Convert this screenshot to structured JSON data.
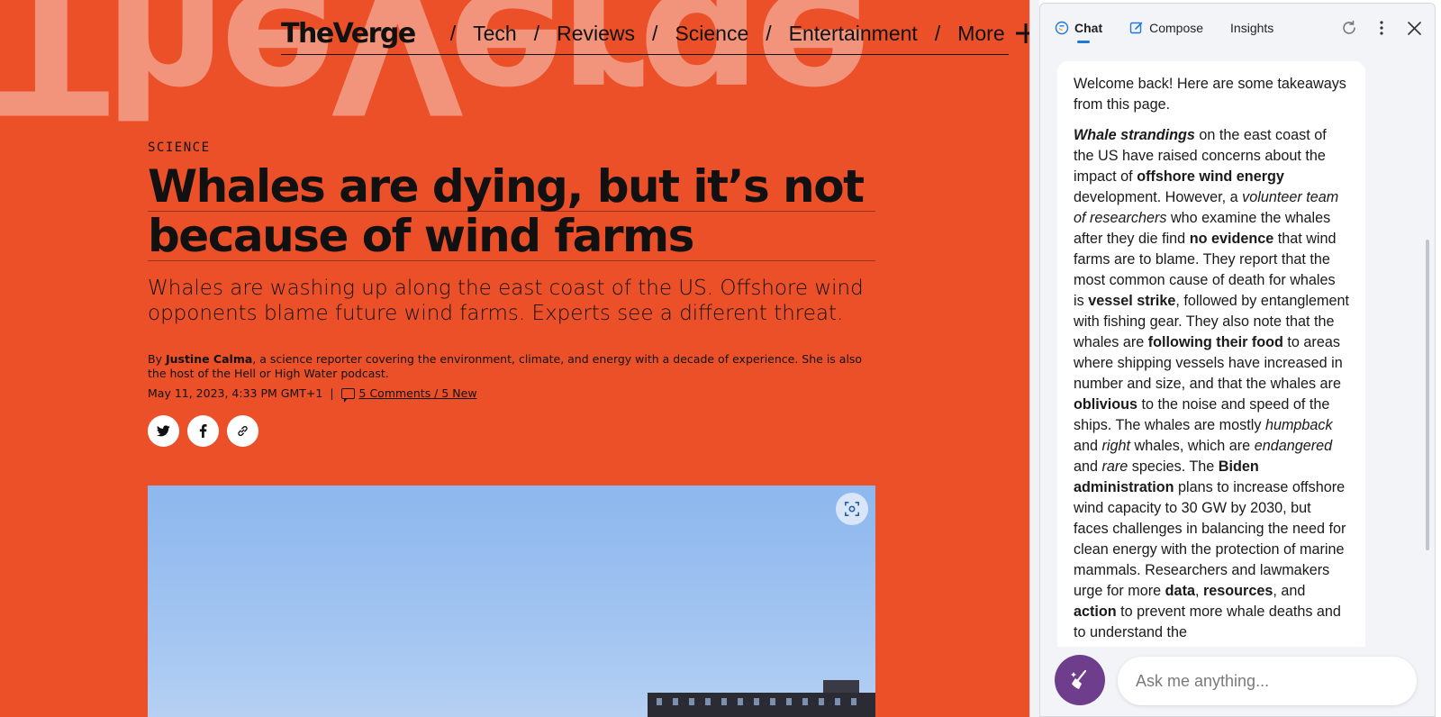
{
  "article_page": {
    "background_color": "#eb5028",
    "bg_logo_text": "TheVerge",
    "nav": {
      "logo": "TheVerge",
      "items": [
        "Tech",
        "Reviews",
        "Science",
        "Entertainment",
        "More"
      ],
      "separator": "/"
    },
    "kicker": "SCIENCE",
    "headline_lines": [
      "Whales are dying, but it’s not",
      "because of wind farms"
    ],
    "dek": "Whales are washing up along the east coast of the US. Offshore wind opponents blame future wind farms. Experts see a different threat.",
    "byline": {
      "prefix": "By ",
      "author": "Justine Calma",
      "bio": ", a science reporter covering the environment, climate, and energy with a decade of experience. She is also the host of the Hell or High Water podcast."
    },
    "date": "May 11, 2023, 4:33 PM GMT+1",
    "meta_separator": "|",
    "comments_link": "5 Comments / 5 New",
    "share_icons": [
      "twitter-icon",
      "facebook-icon",
      "link-icon"
    ]
  },
  "sidebar": {
    "tabs": [
      {
        "label": "Chat",
        "icon": "chat-bubble-icon",
        "active": true
      },
      {
        "label": "Compose",
        "icon": "compose-pencil-icon",
        "active": false
      },
      {
        "label": "Insights",
        "icon": "",
        "active": false
      }
    ],
    "header_icons": [
      "refresh-icon",
      "more-vertical-icon",
      "close-icon"
    ],
    "message": {
      "intro": "Welcome back! Here are some takeaways from this page.",
      "segments": [
        {
          "text": "Whale strandings",
          "style": "bolditalic"
        },
        {
          "text": " on the east coast of the US have raised concerns about the impact of ",
          "style": "normal"
        },
        {
          "text": "offshore wind energy",
          "style": "bold"
        },
        {
          "text": " development. However, a ",
          "style": "normal"
        },
        {
          "text": "volunteer team of researchers",
          "style": "italic"
        },
        {
          "text": " who examine the whales after they die find ",
          "style": "normal"
        },
        {
          "text": "no evidence",
          "style": "bold"
        },
        {
          "text": " that wind farms are to blame. They report that the most common cause of death for whales is ",
          "style": "normal"
        },
        {
          "text": "vessel strike",
          "style": "bold"
        },
        {
          "text": ", followed by entanglement with fishing gear. They also note that the whales are ",
          "style": "normal"
        },
        {
          "text": "following their food",
          "style": "bold"
        },
        {
          "text": " to areas where shipping vessels have increased in number and size, and that the whales are ",
          "style": "normal"
        },
        {
          "text": "oblivious",
          "style": "bold"
        },
        {
          "text": " to the noise and speed of the ships. The whales are mostly ",
          "style": "normal"
        },
        {
          "text": "humpback",
          "style": "italic"
        },
        {
          "text": " and ",
          "style": "normal"
        },
        {
          "text": "right",
          "style": "italic"
        },
        {
          "text": " whales, which are ",
          "style": "normal"
        },
        {
          "text": "endangered",
          "style": "italic"
        },
        {
          "text": " and ",
          "style": "normal"
        },
        {
          "text": "rare",
          "style": "italic"
        },
        {
          "text": " species. The ",
          "style": "normal"
        },
        {
          "text": "Biden administration",
          "style": "bold"
        },
        {
          "text": " plans to increase offshore wind capacity to 30 GW by 2030, but faces challenges in balancing the need for clean energy with the protection of marine mammals. Researchers and lawmakers urge for more ",
          "style": "normal"
        },
        {
          "text": "data",
          "style": "bold"
        },
        {
          "text": ", ",
          "style": "normal"
        },
        {
          "text": "resources",
          "style": "bold"
        },
        {
          "text": ", and ",
          "style": "normal"
        },
        {
          "text": "action",
          "style": "bold"
        },
        {
          "text": " to prevent more whale deaths and to understand the",
          "style": "normal"
        }
      ]
    },
    "input": {
      "placeholder": "Ask me anything...",
      "value": ""
    },
    "broom_icon": "broom-sparkle-icon",
    "accent_color": "#1e78d8",
    "broom_button_color": "#6e3d8c"
  }
}
